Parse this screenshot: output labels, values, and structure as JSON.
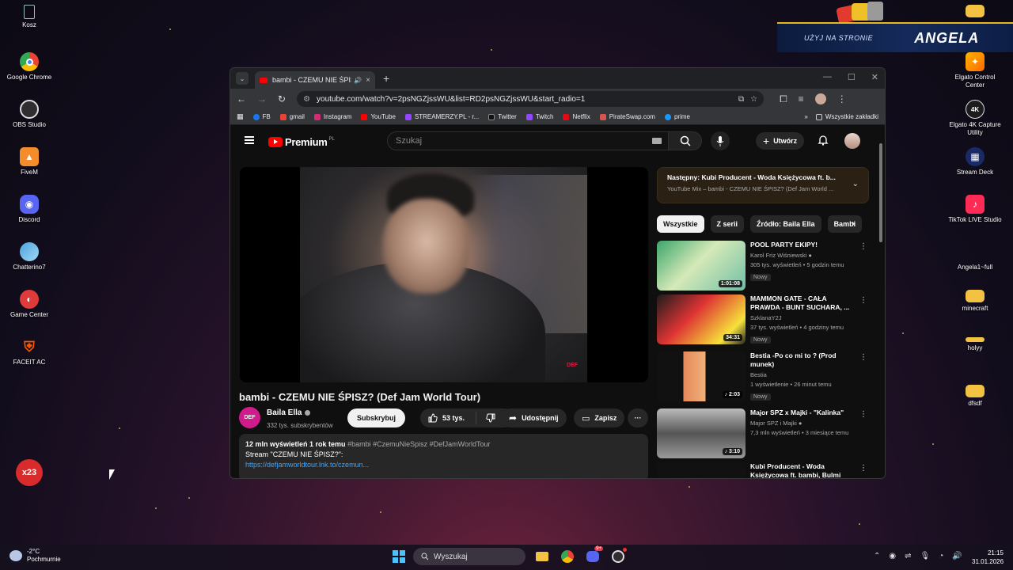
{
  "desktop": {
    "left_icons": [
      {
        "label": "Kosz",
        "icon": "recycle-bin-icon"
      },
      {
        "label": "Google Chrome",
        "icon": "chrome-icon"
      },
      {
        "label": "OBS Studio",
        "icon": "obs-icon"
      },
      {
        "label": "FiveM",
        "icon": "fivem-icon"
      },
      {
        "label": "Discord",
        "icon": "discord-icon"
      },
      {
        "label": "Chatterino7",
        "icon": "chatterino-icon"
      },
      {
        "label": "Game Center",
        "icon": "game-center-icon"
      },
      {
        "label": "FACEIT AC",
        "icon": "faceit-icon"
      }
    ],
    "right_icons": [
      {
        "label": "",
        "icon": "folder-icon"
      },
      {
        "label": "Elgato Control Center",
        "icon": "elgato-icon"
      },
      {
        "label": "Elgato 4K Capture Utility",
        "icon": "elgato-4k-icon"
      },
      {
        "label": "Stream Deck",
        "icon": "stream-deck-icon"
      },
      {
        "label": "TikTok LIVE Studio",
        "icon": "tiktok-icon"
      },
      {
        "label": "Angela1~full",
        "icon": "file-icon"
      },
      {
        "label": "minecraft",
        "icon": "folder-icon"
      },
      {
        "label": "holyy",
        "icon": "folder-icon"
      },
      {
        "label": "dfsdf",
        "icon": "folder-icon"
      }
    ],
    "x23_label": "x23"
  },
  "banner": {
    "use_text": "UŻYJ NA STRONIE",
    "name": "ANGELA"
  },
  "browser": {
    "tab_title": "bambi - CZEMU NIE ŚPISZ?",
    "url": "youtube.com/watch?v=2psNGZjssWU&list=RD2psNGZjssWU&start_radio=1",
    "bookmarks": [
      "FB",
      "gmail",
      "Instagram",
      "YouTube",
      "STREAMERZY.PL - r...",
      "Twitter",
      "Twitch",
      "Netflix",
      "PirateSwap.com",
      "prime"
    ],
    "bookmark_colors": [
      "#1877f2",
      "#ea4335",
      "#d62976",
      "#ff0000",
      "#9146ff",
      "#111111",
      "#9146ff",
      "#e50914",
      "#d9534f",
      "#1a98ff"
    ],
    "all_bookmarks": "Wszystkie zakładki"
  },
  "youtube": {
    "logo": "Premium",
    "logo_country": "PL",
    "search_placeholder": "Szukaj",
    "create_label": "Utwórz",
    "video_title": "bambi - CZEMU NIE ŚPISZ? (Def Jam World Tour)",
    "watermark": "DEF",
    "channel_name": "Baila Ella",
    "channel_avatar_text": "DEF",
    "channel_subs": "332 tys. subskrybentów",
    "subscribe_label": "Subskrybuj",
    "likes": "53 tys.",
    "share_label": "Udostępnij",
    "save_label": "Zapisz",
    "desc_stats": "12 mln wyświetleń  1 rok temu",
    "desc_tags": "#bambi #CzemuNieSpisz #DefJamWorldTour",
    "desc_line2": "Stream \"CZEMU NIE ŚPISZ?\":",
    "desc_link": "https://defjamworldtour.lnk.to/czemun...",
    "next_title": "Następny: Kubi Producent - Woda Księżycowa ft. b...",
    "next_sub": "YouTube Mix – bambi - CZEMU NIE ŚPISZ? (Def Jam World ...",
    "chips": [
      "Wszystkie",
      "Z serii",
      "Źródło: Baila Ella",
      "Bambi"
    ],
    "recs": [
      {
        "title": "POOL PARTY EKIPY!",
        "channel": "Karol Friz Wiśniewski",
        "meta": "305 tys. wyświetleń • 5 godzin temu",
        "badge": "Nowy",
        "duration": "1:01:08"
      },
      {
        "title": "MAMMON GATE - CAŁA PRAWDA - BUNT SUCHARA, ...",
        "channel": "SzklanaY2J",
        "meta": "37 tys. wyświetleń • 4 godziny temu",
        "badge": "Nowy",
        "duration": "34:31"
      },
      {
        "title": "Bestia -Po co mi to ? (Prod munek)",
        "channel": "Bestia",
        "meta": "1 wyświetlenie • 26 minut temu",
        "badge": "Nowy",
        "duration": "2:03"
      },
      {
        "title": "Major SPZ x Majki - \"Kalinka\"",
        "channel": "Major SPZ i Majki",
        "meta": "7,3 mln wyświetleń • 3 miesiące temu",
        "badge": "",
        "duration": "3:10"
      },
      {
        "title": "Kubi Producent - Woda Księżycowa ft. bambi, Bulmi",
        "channel": "",
        "meta": "",
        "badge": "",
        "duration": ""
      }
    ]
  },
  "taskbar": {
    "temp": "-2°C",
    "weather": "Pochmurnie",
    "search": "Wyszukaj",
    "discord_badge": "9+",
    "time": "21:15",
    "date": "31.01.2026"
  }
}
